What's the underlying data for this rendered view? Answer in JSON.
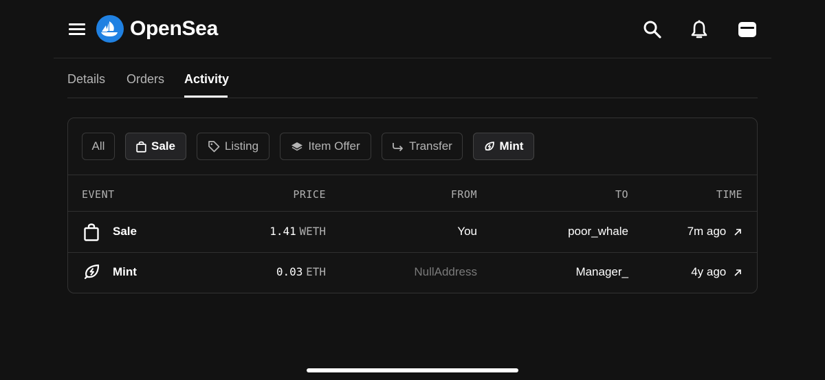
{
  "header": {
    "brand": "OpenSea",
    "icons": [
      "menu-icon",
      "opensea-logo",
      "search-icon",
      "bell-icon",
      "wallet-icon"
    ]
  },
  "tabs": [
    {
      "label": "Details",
      "active": false
    },
    {
      "label": "Orders",
      "active": false
    },
    {
      "label": "Activity",
      "active": true
    }
  ],
  "filters": [
    {
      "label": "All",
      "icon": null,
      "active": false
    },
    {
      "label": "Sale",
      "icon": "shopping-bag-icon",
      "active": true
    },
    {
      "label": "Listing",
      "icon": "tag-icon",
      "active": false
    },
    {
      "label": "Item Offer",
      "icon": "layers-icon",
      "active": false
    },
    {
      "label": "Transfer",
      "icon": "transfer-arrow-icon",
      "active": false
    },
    {
      "label": "Mint",
      "icon": "mint-icon",
      "active": true
    }
  ],
  "table": {
    "columns": [
      "EVENT",
      "PRICE",
      "FROM",
      "TO",
      "TIME"
    ],
    "rows": [
      {
        "event": "Sale",
        "event_icon": "shopping-bag-icon",
        "price": "1.41",
        "unit": "WETH",
        "from": "You",
        "to": "poor_whale",
        "time": "7m ago"
      },
      {
        "event": "Mint",
        "event_icon": "mint-icon",
        "price": "0.03",
        "unit": "ETH",
        "from": "NullAddress",
        "to": "Manager_",
        "time": "4y ago"
      }
    ]
  },
  "colors": {
    "background": "#121212",
    "card_border": "#333333",
    "brand_blue": "#2081e2",
    "muted_text": "#7a7a7a"
  }
}
